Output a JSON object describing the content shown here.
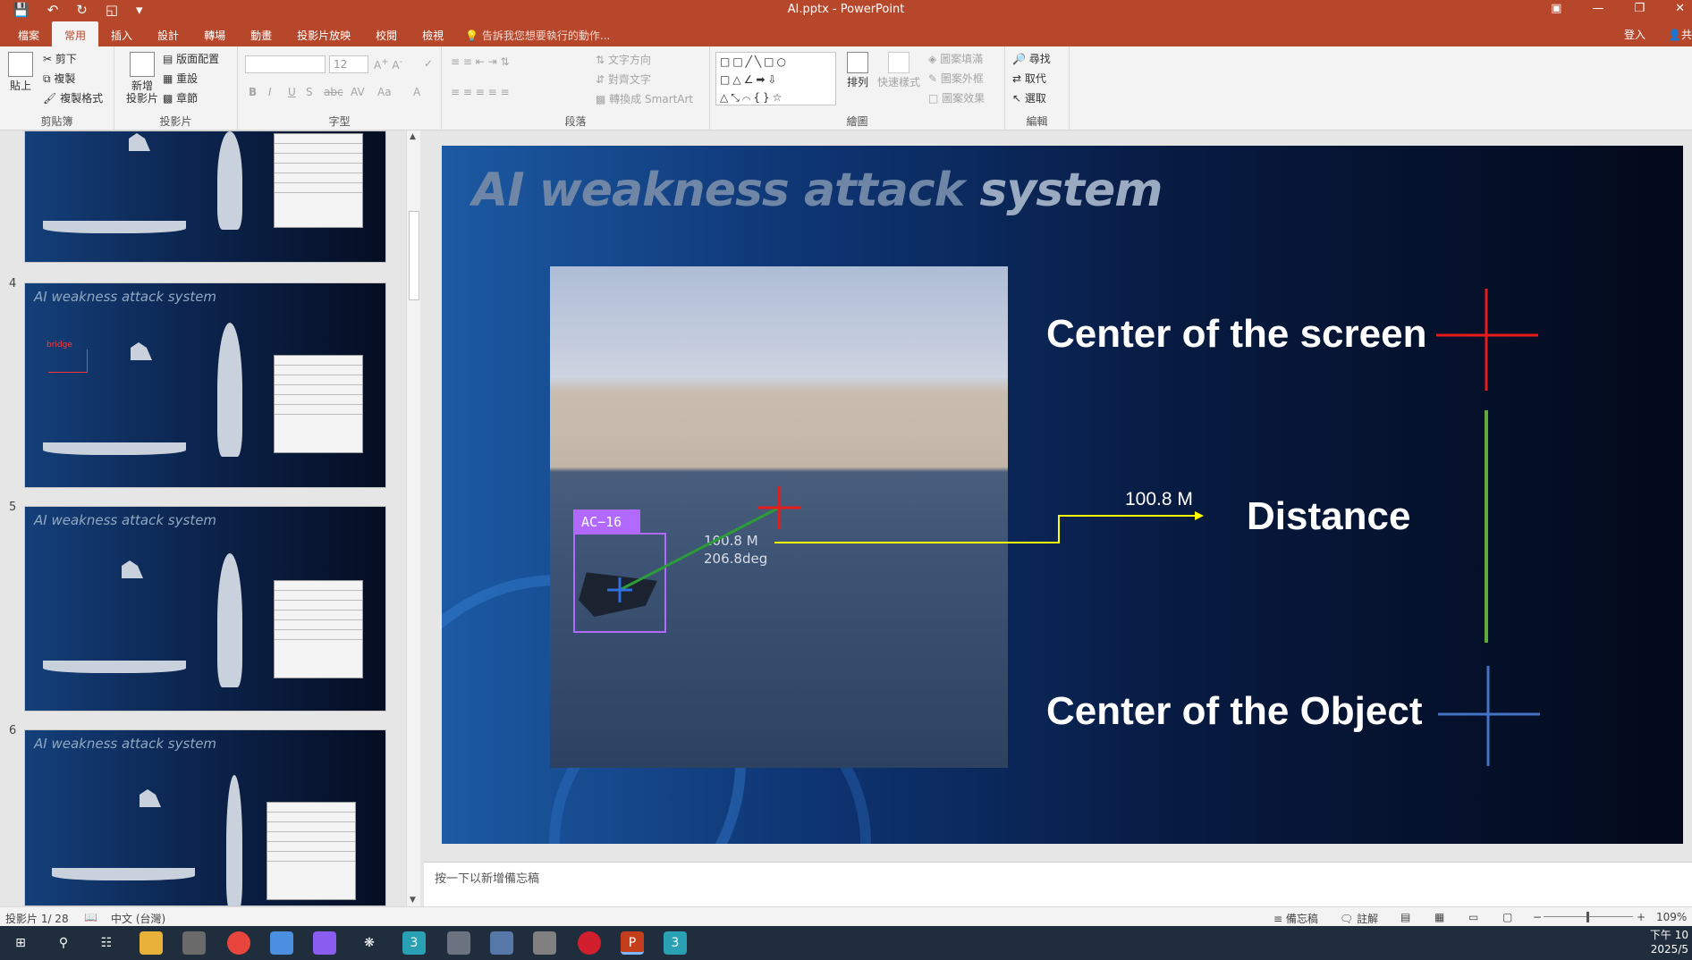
{
  "window": {
    "title": "AI.pptx - PowerPoint"
  },
  "ribbon_tabs": [
    "檔案",
    "常用",
    "插入",
    "設計",
    "轉場",
    "動畫",
    "投影片放映",
    "校閱",
    "檢視"
  ],
  "active_tab": "常用",
  "tell_me": "告訴我您想要執行的動作...",
  "account": {
    "login": "登入",
    "share": "共用"
  },
  "clipboard": {
    "paste": "貼上",
    "cut": "剪下",
    "copy": "複製",
    "format_painter": "複製格式",
    "label": "剪貼簿"
  },
  "slides": {
    "new_slide": "新增\n投影片",
    "layout": "版面配置",
    "reset": "重設",
    "section": "章節",
    "label": "投影片"
  },
  "font": {
    "size": "12",
    "label": "字型",
    "b": "B",
    "i": "I",
    "u": "U",
    "s": "S",
    "abc": "abc",
    "av": "AV",
    "aa": "Aa",
    "a_color": "A"
  },
  "paragraph": {
    "text_direction": "文字方向",
    "align_text": "對齊文字",
    "smartart": "轉換成 SmartArt",
    "label": "段落"
  },
  "drawing": {
    "arrange": "排列",
    "quick_styles": "快速樣式",
    "shape_fill": "圖案填滿",
    "shape_outline": "圖案外框",
    "shape_effects": "圖案效果",
    "label": "繪圖"
  },
  "editing": {
    "find": "尋找",
    "replace": "取代",
    "select": "選取",
    "label": "編輯"
  },
  "thumbnails": [
    {
      "num": "",
      "title": ""
    },
    {
      "num": "4",
      "title": "AI weakness attack system",
      "tag": "bridge"
    },
    {
      "num": "5",
      "title": "AI weakness attack system"
    },
    {
      "num": "6",
      "title": "AI weakness attack system"
    }
  ],
  "slide": {
    "title_a": "AI weakness attack ",
    "title_b": "system",
    "bbox_label": "AC−16",
    "overlay_distance": "100.8 M",
    "overlay_angle": "206.8deg",
    "distance_value": "100.8 M",
    "legend_center_screen": "Center of the screen",
    "legend_distance": "Distance",
    "legend_center_object": "Center of the Object",
    "colors": {
      "screen": "#e81b1b",
      "distance": "#5ea93b",
      "object": "#4472c4",
      "connector": "#ffff00"
    }
  },
  "notes_placeholder": "按一下以新增備忘稿",
  "status": {
    "slide_counter": "投影片 1/ 28",
    "language": "中文 (台灣)",
    "notes": "備忘稿",
    "comments": "註解",
    "zoom": "109%"
  },
  "clock": {
    "time": "下午 10",
    "date": "2025/5"
  }
}
